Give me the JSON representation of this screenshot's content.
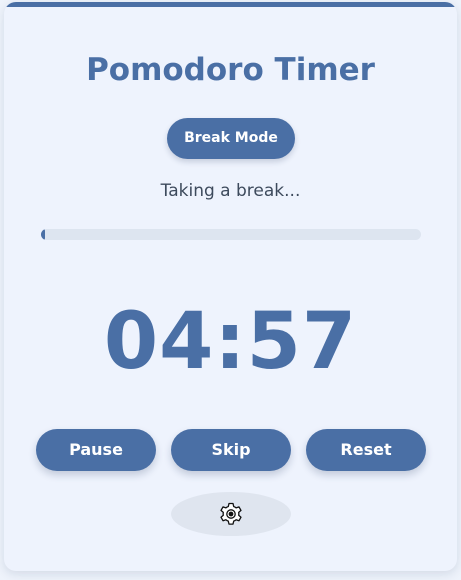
{
  "app": {
    "title": "Pomodoro Timer"
  },
  "mode": {
    "label": "Break Mode"
  },
  "status": {
    "text": "Taking a break..."
  },
  "progress": {
    "fraction": 0.01
  },
  "timer": {
    "display": "04:57"
  },
  "controls": {
    "pause_label": "Pause",
    "skip_label": "Skip",
    "reset_label": "Reset"
  },
  "settings": {
    "icon": "gear-icon"
  },
  "colors": {
    "accent": "#4a6fa5",
    "background": "#eef3fd",
    "track": "#dde5f0"
  }
}
